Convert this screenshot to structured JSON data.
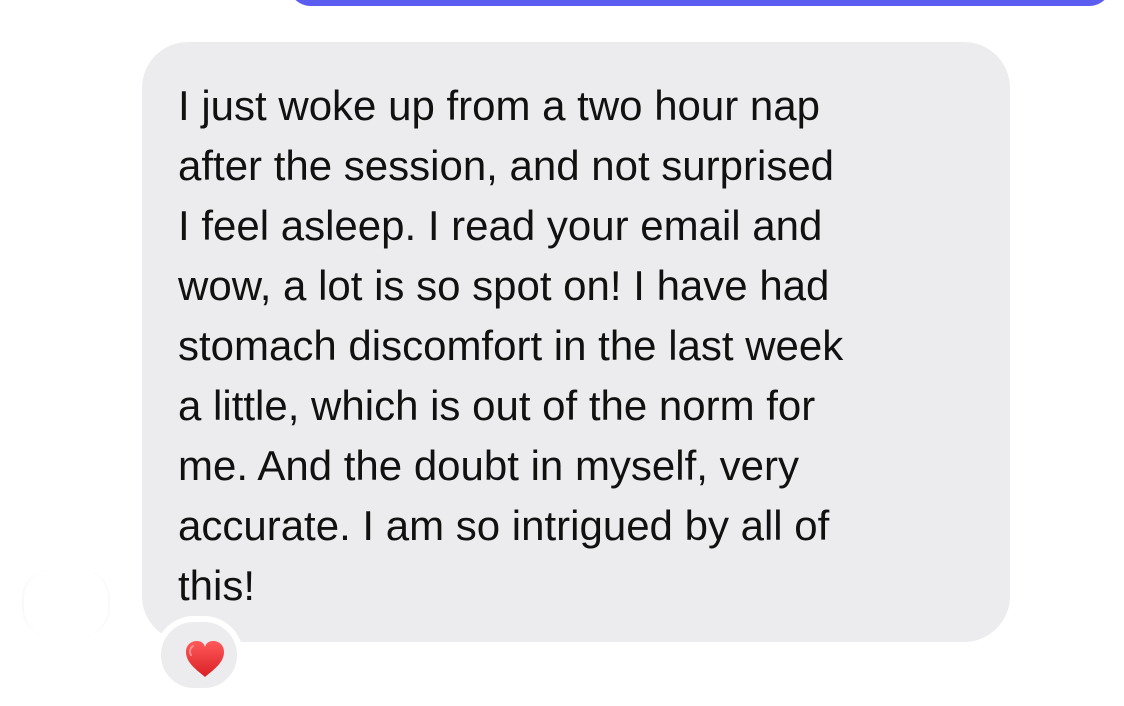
{
  "message": {
    "lines": "I just woke up from a two hour nap\nafter the session, and not surprised\nI feel asleep. I read your email and\nwow, a lot is so spot on! I have had\nstomach discomfort in the last week\na little, which is out of the norm for\nme. And the doubt in myself, very\naccurate. I am so intrigued by all of\nthis!"
  },
  "reaction": {
    "icon": "heart-icon",
    "color": "#e62f2f"
  },
  "colors": {
    "incoming_bubble": "#ececee",
    "outgoing_bubble": "#5b5cf0",
    "text": "#111111"
  }
}
